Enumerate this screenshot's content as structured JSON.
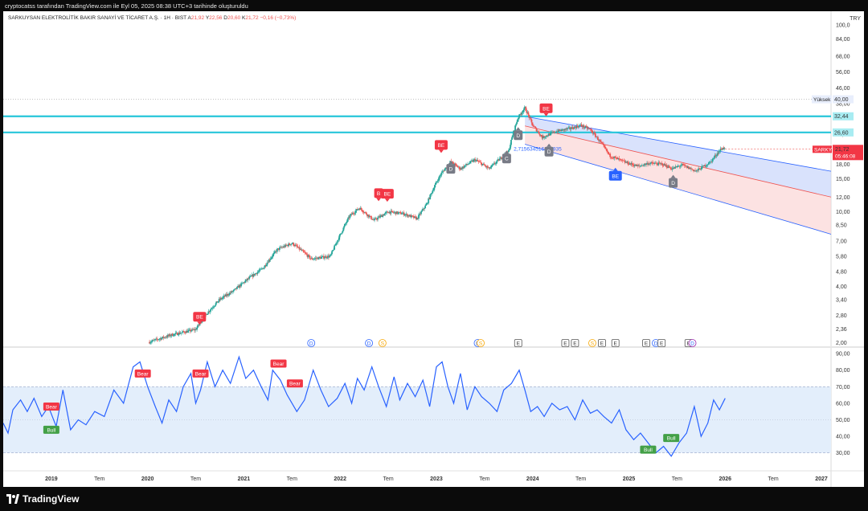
{
  "header": {
    "created_by": "cryptocatss tarafından TradingView.com ile Eyl 05, 2025 08:38 UTC+3 tarihinde oluşturuldu"
  },
  "symbol_bar": {
    "name": "SARKUYSAN ELEKTROLİTİK BAKIR SANAYİ VE TİCARET A.Ş. · 1H · BIST",
    "open_label": "A",
    "open": "21,92",
    "high_label": "Y",
    "high": "22,56",
    "low_label": "D",
    "low": "20,60",
    "close_label": "K",
    "close": "21,72",
    "change": "−0,16 (−0,73%)"
  },
  "currency": "TRY",
  "footer": {
    "brand": "TradingView"
  },
  "colors": {
    "up": "#26a69a",
    "down": "#ef5350",
    "rsi_line": "#2962ff",
    "level_line": "#26c6da",
    "channel_upper_fill": "#c9d6fb",
    "channel_lower_fill": "#fbd5d5",
    "bear_label": "#f23645",
    "bull_label": "#43a047",
    "rsi_band": "#e3eefb"
  },
  "chart_data": [
    {
      "type": "candlestick",
      "title": "SARKUYSAN ELEKTROLİTİK BAKIR SANAYİ VE TİCARET A.Ş. · 1H · BIST",
      "scale": "log",
      "ylim": [
        1.95,
        105
      ],
      "y_ticks": [
        "100,0",
        "84,00",
        "68,00",
        "56,00",
        "46,00",
        "38,00",
        "32,00",
        "26,00",
        "22,00",
        "18,00",
        "15,00",
        "12,00",
        "10,00",
        "8,50",
        "7,00",
        "5,80",
        "4,80",
        "4,00",
        "3,40",
        "2,80",
        "2,36",
        "2,00"
      ],
      "x_ticks": [
        "2019",
        "Tem",
        "2020",
        "Tem",
        "2021",
        "Tem",
        "2022",
        "Tem",
        "2023",
        "Tem",
        "2024",
        "Tem",
        "2025",
        "Tem",
        "2026",
        "Tem",
        "2027"
      ],
      "x_range": [
        2018.5,
        2027.1
      ],
      "price_path": [
        [
          2019.0,
          1.95
        ],
        [
          2019.6,
          1.95
        ],
        [
          2020.0,
          2.0
        ],
        [
          2020.25,
          2.2
        ],
        [
          2020.5,
          2.35
        ],
        [
          2020.6,
          2.8
        ],
        [
          2020.75,
          3.4
        ],
        [
          2020.9,
          3.8
        ],
        [
          2021.05,
          4.4
        ],
        [
          2021.2,
          5.0
        ],
        [
          2021.35,
          6.3
        ],
        [
          2021.5,
          6.8
        ],
        [
          2021.7,
          5.6
        ],
        [
          2021.9,
          5.8
        ],
        [
          2022.0,
          7.5
        ],
        [
          2022.1,
          9.5
        ],
        [
          2022.2,
          10.5
        ],
        [
          2022.35,
          9.0
        ],
        [
          2022.5,
          10.0
        ],
        [
          2022.65,
          9.8
        ],
        [
          2022.8,
          9.2
        ],
        [
          2022.9,
          11.0
        ],
        [
          2023.05,
          16.0
        ],
        [
          2023.15,
          18.5
        ],
        [
          2023.25,
          17.0
        ],
        [
          2023.4,
          19.0
        ],
        [
          2023.55,
          17.0
        ],
        [
          2023.75,
          21.0
        ],
        [
          2023.85,
          32.0
        ],
        [
          2023.92,
          36.0
        ],
        [
          2024.0,
          29.0
        ],
        [
          2024.1,
          25.0
        ],
        [
          2024.25,
          27.0
        ],
        [
          2024.4,
          28.0
        ],
        [
          2024.5,
          29.0
        ],
        [
          2024.6,
          27.5
        ],
        [
          2024.8,
          20.0
        ],
        [
          2024.95,
          18.5
        ],
        [
          2025.1,
          17.5
        ],
        [
          2025.2,
          18.2
        ],
        [
          2025.35,
          18.0
        ],
        [
          2025.45,
          17.0
        ],
        [
          2025.55,
          17.8
        ],
        [
          2025.7,
          16.5
        ],
        [
          2025.85,
          18.5
        ],
        [
          2025.95,
          21.5
        ],
        [
          2026.0,
          22.2
        ]
      ],
      "last_price": "21,72",
      "last_price_ticker": "SARKY",
      "countdown": "05:46:08",
      "levels": [
        {
          "label": "Yüksek",
          "value": "40,00",
          "style": "dotted"
        },
        {
          "label": "",
          "value": "32,44",
          "style": "solid"
        },
        {
          "label": "",
          "value": "26,60",
          "style": "solid"
        }
      ],
      "regression_channel": {
        "start": {
          "x": 2023.92,
          "upper": 32.4,
          "middle": 28.8,
          "lower": 23.0
        },
        "end": {
          "x": 2027.1,
          "upper": 16.5,
          "middle": 12.0,
          "lower": 7.6
        },
        "label": "2,715634516648935"
      },
      "signal_labels": [
        {
          "text": "BE",
          "x": 2020.54,
          "y": 2.75,
          "kind": "bear"
        },
        {
          "text": "B",
          "x": 2022.4,
          "y": 12.6,
          "kind": "bear"
        },
        {
          "text": "BE",
          "x": 2022.49,
          "y": 12.5,
          "kind": "bear"
        },
        {
          "text": "BE",
          "x": 2023.05,
          "y": 22.8,
          "kind": "bear"
        },
        {
          "text": "BE",
          "x": 2024.14,
          "y": 35.8,
          "kind": "bear"
        },
        {
          "text": "BE",
          "x": 2024.86,
          "y": 15.6,
          "kind": "blue"
        },
        {
          "text": "D",
          "x": 2023.15,
          "y": 17.0,
          "kind": "gray"
        },
        {
          "text": "C",
          "x": 2023.73,
          "y": 19.3,
          "kind": "gray"
        },
        {
          "text": "D",
          "x": 2023.85,
          "y": 25.7,
          "kind": "gray"
        },
        {
          "text": "D",
          "x": 2024.17,
          "y": 21.0,
          "kind": "gray"
        },
        {
          "text": "D",
          "x": 2025.46,
          "y": 14.3,
          "kind": "gray"
        }
      ],
      "event_markers": [
        {
          "text": "D",
          "x": 2021.7,
          "kind": "d"
        },
        {
          "text": "D",
          "x": 2022.3,
          "kind": "d"
        },
        {
          "text": "S",
          "x": 2022.44,
          "kind": "s"
        },
        {
          "text": "D",
          "x": 2023.43,
          "kind": "d"
        },
        {
          "text": "S",
          "x": 2023.46,
          "kind": "s"
        },
        {
          "text": "E",
          "x": 2023.85,
          "kind": "e"
        },
        {
          "text": "E",
          "x": 2024.34,
          "kind": "e"
        },
        {
          "text": "E",
          "x": 2024.44,
          "kind": "e"
        },
        {
          "text": "S",
          "x": 2024.62,
          "kind": "s"
        },
        {
          "text": "E",
          "x": 2024.72,
          "kind": "e"
        },
        {
          "text": "E",
          "x": 2024.86,
          "kind": "e"
        },
        {
          "text": "E",
          "x": 2025.18,
          "kind": "e"
        },
        {
          "text": "D",
          "x": 2025.28,
          "kind": "d"
        },
        {
          "text": "E",
          "x": 2025.34,
          "kind": "e"
        },
        {
          "text": "E",
          "x": 2025.62,
          "kind": "e"
        },
        {
          "text": "D",
          "x": 2025.66,
          "kind": "d2"
        }
      ]
    },
    {
      "type": "line",
      "title": "",
      "ylim": [
        25,
        92
      ],
      "y_ticks": [
        "90,00",
        "80,00",
        "70,00",
        "60,00",
        "50,00",
        "40,00",
        "30,00"
      ],
      "band": [
        30,
        70
      ],
      "midline": 50,
      "x_range": [
        2018.5,
        2027.1
      ],
      "x": [
        2018.5,
        2018.55,
        2018.6,
        2018.68,
        2018.75,
        2018.82,
        2018.9,
        2018.97,
        2019.05,
        2019.12,
        2019.2,
        2019.28,
        2019.36,
        2019.45,
        2019.55,
        2019.65,
        2019.75,
        2019.85,
        2019.92,
        2020.0,
        2020.08,
        2020.15,
        2020.22,
        2020.3,
        2020.37,
        2020.45,
        2020.5,
        2020.55,
        2020.62,
        2020.7,
        2020.78,
        2020.86,
        2020.95,
        2021.02,
        2021.1,
        2021.18,
        2021.25,
        2021.3,
        2021.38,
        2021.45,
        2021.55,
        2021.63,
        2021.72,
        2021.8,
        2021.88,
        2021.97,
        2022.05,
        2022.12,
        2022.18,
        2022.25,
        2022.33,
        2022.4,
        2022.48,
        2022.56,
        2022.62,
        2022.7,
        2022.78,
        2022.86,
        2022.93,
        2023.0,
        2023.06,
        2023.12,
        2023.18,
        2023.25,
        2023.32,
        2023.4,
        2023.47,
        2023.55,
        2023.63,
        2023.7,
        2023.78,
        2023.86,
        2023.92,
        2023.98,
        2024.05,
        2024.12,
        2024.2,
        2024.28,
        2024.36,
        2024.44,
        2024.52,
        2024.6,
        2024.67,
        2024.74,
        2024.82,
        2024.9,
        2024.97,
        2025.05,
        2025.12,
        2025.2,
        2025.28,
        2025.36,
        2025.44,
        2025.52,
        2025.6,
        2025.68,
        2025.75,
        2025.82,
        2025.88,
        2025.94,
        2026.0
      ],
      "values": [
        48,
        42,
        56,
        62,
        55,
        63,
        52,
        58,
        46,
        68,
        44,
        50,
        47,
        55,
        52,
        68,
        60,
        82,
        85,
        70,
        58,
        48,
        62,
        55,
        70,
        78,
        60,
        68,
        85,
        70,
        80,
        72,
        88,
        75,
        80,
        70,
        62,
        80,
        74,
        65,
        55,
        62,
        80,
        68,
        58,
        63,
        72,
        60,
        75,
        68,
        82,
        70,
        58,
        76,
        62,
        72,
        64,
        74,
        58,
        82,
        85,
        70,
        60,
        78,
        56,
        70,
        64,
        60,
        55,
        68,
        72,
        80,
        68,
        55,
        58,
        52,
        60,
        56,
        58,
        50,
        62,
        54,
        56,
        52,
        48,
        56,
        44,
        38,
        42,
        36,
        30,
        34,
        28,
        36,
        42,
        58,
        40,
        48,
        62,
        56,
        63
      ],
      "annotations": [
        {
          "text": "Bear",
          "x": 2019.0,
          "y": 58,
          "kind": "bear"
        },
        {
          "text": "Bull",
          "x": 2019.0,
          "y": 44,
          "kind": "bull"
        },
        {
          "text": "Bear",
          "x": 2019.95,
          "y": 78,
          "kind": "bear"
        },
        {
          "text": "Bear",
          "x": 2020.55,
          "y": 78,
          "kind": "bear"
        },
        {
          "text": "Bear",
          "x": 2021.36,
          "y": 84,
          "kind": "bear"
        },
        {
          "text": "Bear",
          "x": 2021.53,
          "y": 72,
          "kind": "bear"
        },
        {
          "text": "Bull",
          "x": 2025.2,
          "y": 32,
          "kind": "bull"
        },
        {
          "text": "Bull",
          "x": 2025.44,
          "y": 39,
          "kind": "bull"
        }
      ]
    }
  ]
}
